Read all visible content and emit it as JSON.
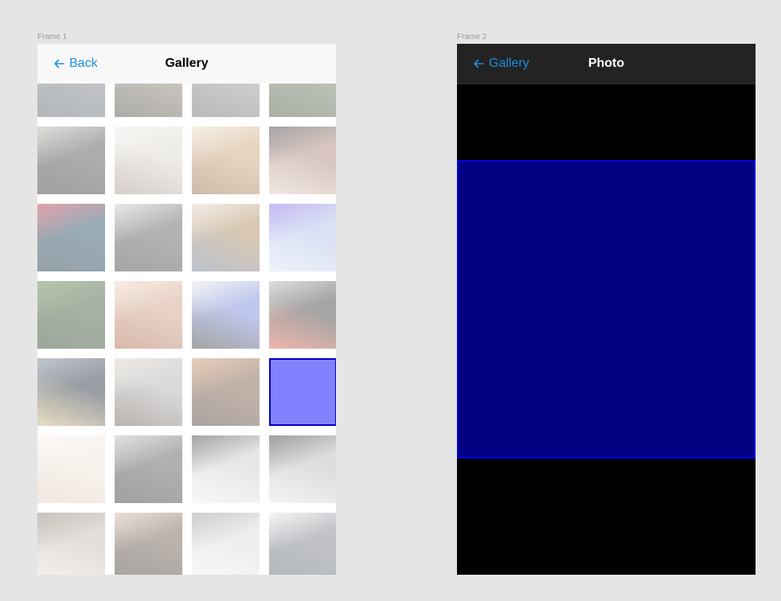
{
  "frames": {
    "frame1_label": "Frame 1",
    "frame2_label": "Frame 2"
  },
  "gallery": {
    "back_label": "Back",
    "title": "Gallery",
    "columns": 4,
    "thumbnails": [
      {
        "colors": [
          "#6a6f7a",
          "#d6d6d6",
          "#4b5560"
        ],
        "selected": false
      },
      {
        "colors": [
          "#7d7464",
          "#bfb3a0",
          "#3e3a34"
        ],
        "selected": false
      },
      {
        "colors": [
          "#8a8a8a",
          "#c8c8c8",
          "#5a5a5a"
        ],
        "selected": false
      },
      {
        "colors": [
          "#5d6b4f",
          "#a49a7a",
          "#3a4430"
        ],
        "selected": false
      },
      {
        "colors": [
          "#3c3d42",
          "#b8b0a4",
          "#1f1f22"
        ],
        "selected": false
      },
      {
        "colors": [
          "#d9d3cb",
          "#efece8",
          "#9c8d7e"
        ],
        "selected": false
      },
      {
        "colors": [
          "#c79a6c",
          "#e8d7c3",
          "#8f5f3a"
        ],
        "selected": false
      },
      {
        "colors": [
          "#a6786b",
          "#2a2a2a",
          "#d9c8b8"
        ],
        "selected": false
      },
      {
        "colors": [
          "#0d3a55",
          "#b8243a",
          "#072030"
        ],
        "selected": false
      },
      {
        "colors": [
          "#4c4c4c",
          "#c9c9c9",
          "#2c2c2c"
        ],
        "selected": false
      },
      {
        "colors": [
          "#a47c4e",
          "#e3d6c6",
          "#5e6f8c"
        ],
        "selected": false
      },
      {
        "colors": [
          "#a8b8e8",
          "#7b5be6",
          "#d8e0f5"
        ],
        "selected": false
      },
      {
        "colors": [
          "#2c4a26",
          "#4f7a3a",
          "#1a2c16"
        ],
        "selected": false
      },
      {
        "colors": [
          "#c9977a",
          "#f1d3bd",
          "#a25a3a"
        ],
        "selected": false
      },
      {
        "colors": [
          "#6b7bd6",
          "#e8e8e8",
          "#2b2b2b"
        ],
        "selected": false
      },
      {
        "colors": [
          "#2a2a2a",
          "#b2b2b2",
          "#d8503c"
        ],
        "selected": false
      },
      {
        "colors": [
          "#0f1a28",
          "#6d7c90",
          "#c8b070"
        ],
        "selected": false
      },
      {
        "colors": [
          "#a8a8a8",
          "#d8cdc0",
          "#5a4c44"
        ],
        "selected": false
      },
      {
        "colors": [
          "#6e4a33",
          "#c88a5a",
          "#3a2a20"
        ],
        "selected": true
      },
      {
        "colors": [
          "#8282ff",
          "#8282ff",
          "#8282ff"
        ],
        "selected": false
      },
      {
        "colors": [
          "#efe2d6",
          "#f7f0ea",
          "#dcc8b8"
        ],
        "selected": false
      },
      {
        "colors": [
          "#454545",
          "#b7b7b7",
          "#202020"
        ],
        "selected": false
      },
      {
        "colors": [
          "#c8c8c8",
          "#2a2a2a",
          "#efefef"
        ],
        "selected": false
      },
      {
        "colors": [
          "#b0b0b0",
          "#1e1e1e",
          "#e6e6e6"
        ],
        "selected": false
      },
      {
        "colors": [
          "#bdb3a6",
          "#7c6f62",
          "#e6e0d8"
        ],
        "selected": false
      },
      {
        "colors": [
          "#5b4a3e",
          "#d2b79d",
          "#2c241e"
        ],
        "selected": false
      },
      {
        "colors": [
          "#d8d8d8",
          "#8a8a8a",
          "#f0f0f0"
        ],
        "selected": false
      },
      {
        "colors": [
          "#6a6f7a",
          "#e8e8e8",
          "#4b5560"
        ],
        "selected": false
      }
    ]
  },
  "photo_view": {
    "back_label": "Gallery",
    "title": "Photo",
    "photo_color": "#000080",
    "photo_border": "#0000e6"
  },
  "colors": {
    "accent": "#1a8fe3",
    "selection_fill": "#8282ff",
    "selection_border": "#0000d0"
  }
}
